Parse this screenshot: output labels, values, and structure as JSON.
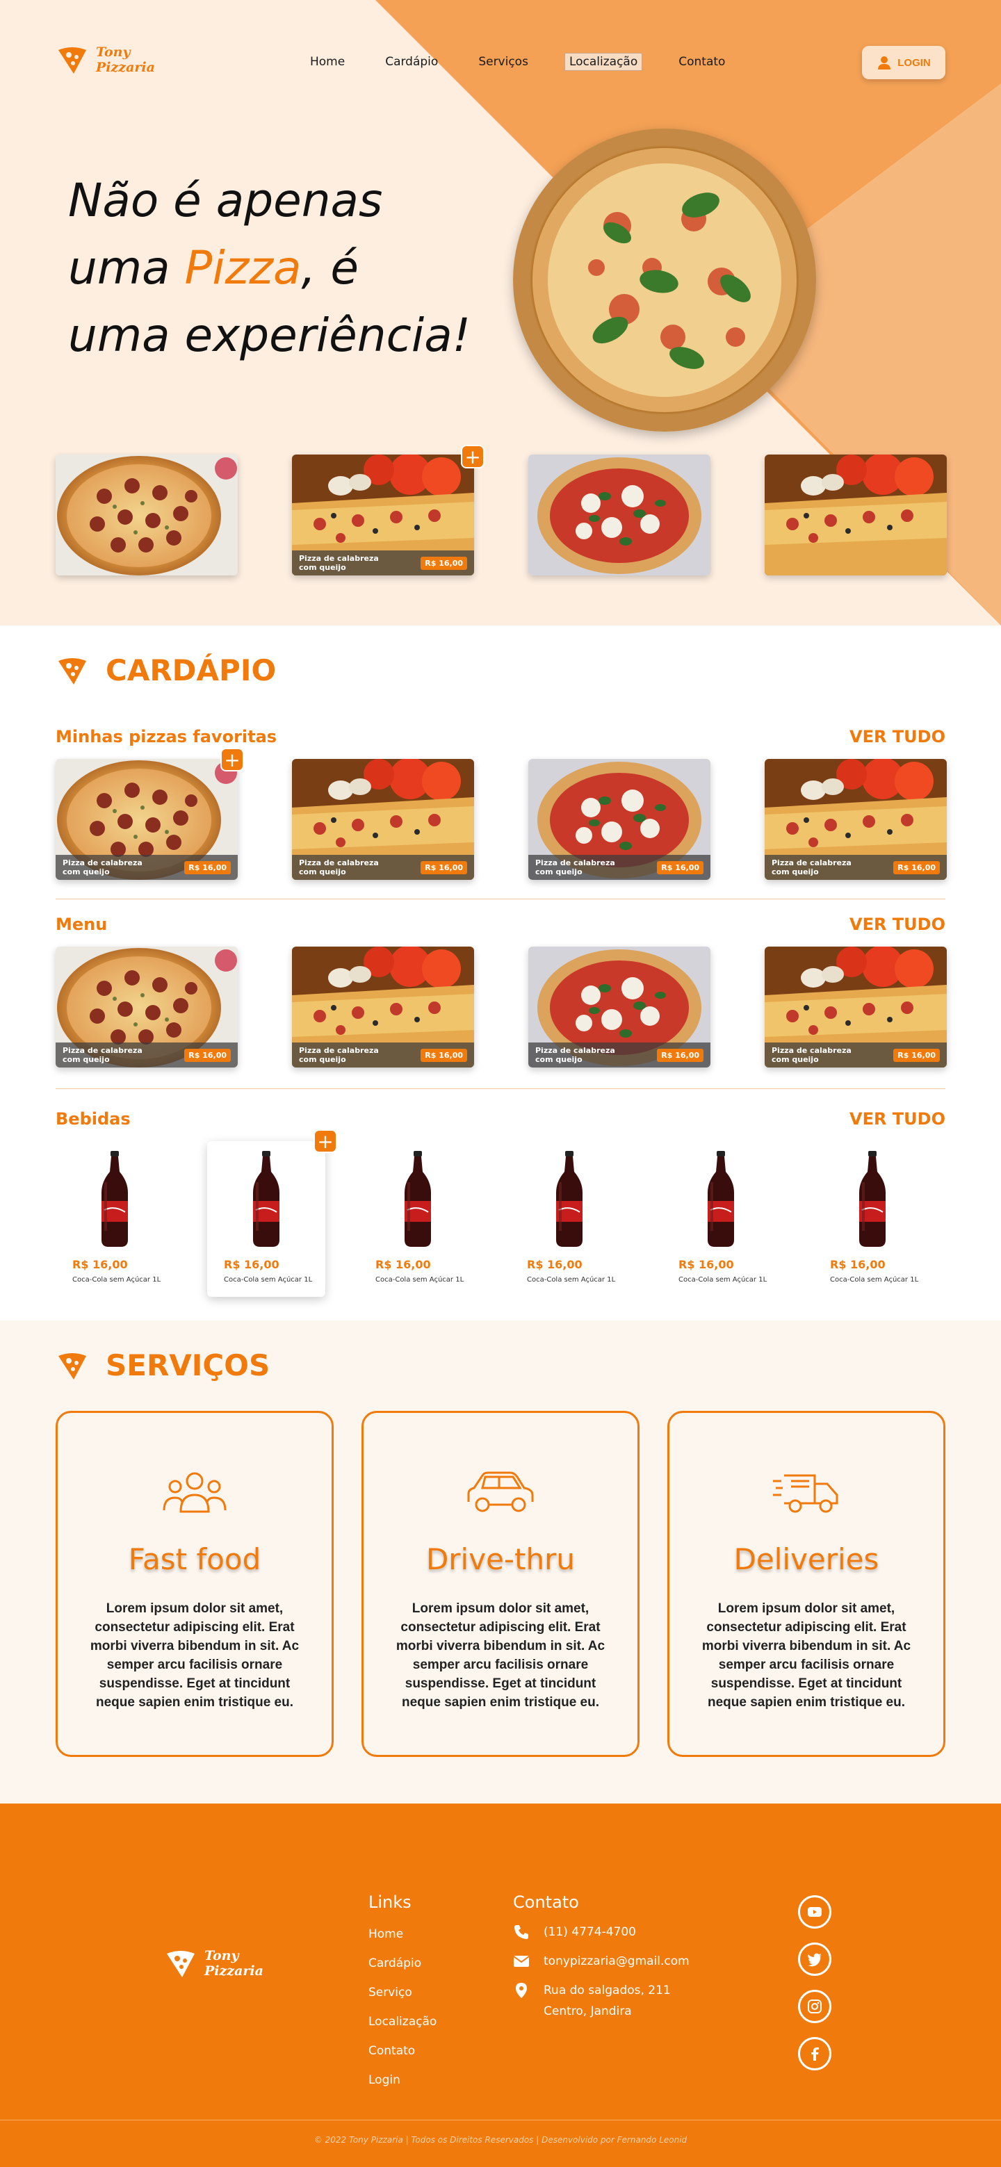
{
  "brand": {
    "line1": "Tony",
    "line2": "Pizzaria",
    "accent": "#f07a0c"
  },
  "nav": {
    "items": [
      "Home",
      "Cardápio",
      "Serviços",
      "Localização",
      "Contato"
    ],
    "active": "Localização",
    "login_label": "LOGIN"
  },
  "hero": {
    "line1": "Não é apenas",
    "line2_before": "uma ",
    "line2_accent": "Pizza",
    "line2_after": ", é",
    "line3": "uma experiência!"
  },
  "hero_thumbs": [
    {
      "name": "",
      "price": ""
    },
    {
      "name": "Pizza de calabreza com queijo",
      "price": "R$ 16,00"
    },
    {
      "name": "",
      "price": ""
    },
    {
      "name": "",
      "price": ""
    }
  ],
  "cardapio": {
    "title": "CARDÁPIO",
    "see_all": "VER TUDO",
    "favorites_title": "Minhas pizzas favoritas",
    "menu_title": "Menu",
    "drinks_title": "Bebidas",
    "pizzas": [
      {
        "name": "Pizza de calabreza com queijo",
        "price": "R$ 16,00"
      },
      {
        "name": "Pizza de calabreza com queijo",
        "price": "R$ 16,00"
      },
      {
        "name": "Pizza de calabreza com queijo",
        "price": "R$ 16,00"
      },
      {
        "name": "Pizza de calabreza com queijo",
        "price": "R$ 16,00"
      }
    ],
    "drinks": [
      {
        "name": "Coca-Cola sem Açúcar 1L",
        "price": "R$ 16,00"
      },
      {
        "name": "Coca-Cola sem Açúcar 1L",
        "price": "R$ 16,00"
      },
      {
        "name": "Coca-Cola sem Açúcar 1L",
        "price": "R$ 16,00"
      },
      {
        "name": "Coca-Cola sem Açúcar 1L",
        "price": "R$ 16,00"
      },
      {
        "name": "Coca-Cola sem Açúcar 1L",
        "price": "R$ 16,00"
      },
      {
        "name": "Coca-Cola sem Açúcar 1L",
        "price": "R$ 16,00"
      }
    ]
  },
  "servicos": {
    "title": "SERVIÇOS",
    "cards": [
      {
        "title": "Fast food",
        "icon": "people-group-icon",
        "text": "Lorem ipsum dolor sit amet, consectetur adipiscing elit. Erat morbi viverra bibendum in sit. Ac semper arcu facilisis ornare suspendisse. Eget at tincidunt neque sapien enim tristique eu."
      },
      {
        "title": "Drive-thru",
        "icon": "car-icon",
        "text": "Lorem ipsum dolor sit amet, consectetur adipiscing elit. Erat morbi viverra bibendum in sit. Ac semper arcu facilisis ornare suspendisse. Eget at tincidunt neque sapien enim tristique eu."
      },
      {
        "title": "Deliveries",
        "icon": "delivery-truck-icon",
        "text": "Lorem ipsum dolor sit amet, consectetur adipiscing elit. Erat morbi viverra bibendum in sit. Ac semper arcu facilisis ornare suspendisse. Eget at tincidunt neque sapien enim tristique eu."
      }
    ]
  },
  "footer": {
    "links_title": "Links",
    "links": [
      "Home",
      "Cardápio",
      "Serviço",
      "Localização",
      "Contato",
      "Login"
    ],
    "contact_title": "Contato",
    "phone": "(11) 4774-4700",
    "email": "tonypizzaria@gmail.com",
    "address_line1": "Rua do salgados, 211",
    "address_line2": "Centro, Jandira",
    "social": [
      "youtube-icon",
      "twitter-icon",
      "instagram-icon",
      "facebook-icon"
    ],
    "copyright": "© 2022 Tony Pizzaria | Todos os Direitos Reservados | Desenvolvido por Fernando Leonid"
  }
}
